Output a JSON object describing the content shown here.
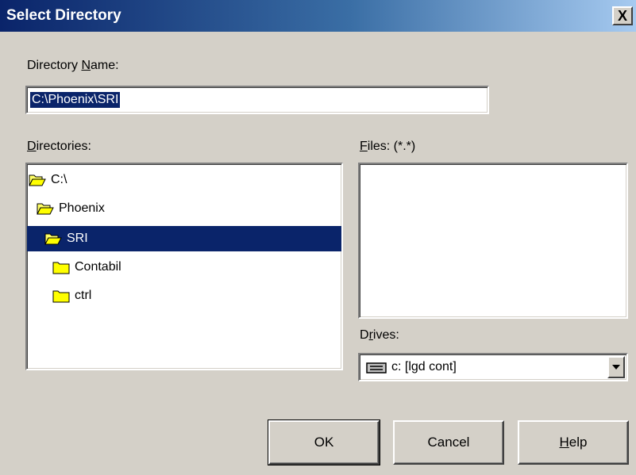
{
  "window": {
    "title": "Select Directory",
    "close_label": "X"
  },
  "directory_name": {
    "label_prefix": "Directory ",
    "label_accel": "N",
    "label_suffix": "ame:",
    "value": "C:\\Phoenix\\SRI"
  },
  "directories": {
    "label_accel": "D",
    "label_suffix": "irectories:",
    "items": [
      {
        "label": "C:\\",
        "type": "open-folder",
        "selected": false
      },
      {
        "label": "Phoenix",
        "type": "open-folder",
        "selected": false
      },
      {
        "label": "SRI",
        "type": "open-folder",
        "selected": true
      },
      {
        "label": "Contabil",
        "type": "closed-folder",
        "selected": false
      },
      {
        "label": "ctrl",
        "type": "closed-folder",
        "selected": false
      }
    ]
  },
  "files": {
    "label_accel": "F",
    "label_suffix": "iles: (*.*)",
    "items": []
  },
  "drives": {
    "label_prefix": "D",
    "label_accel": "r",
    "label_suffix": "ives:",
    "selected": "c: [lgd cont]",
    "icon": "drive-icon"
  },
  "buttons": {
    "ok": "OK",
    "cancel": "Cancel",
    "help_accel": "H",
    "help_suffix": "elp"
  },
  "colors": {
    "selection": "#0a246a",
    "dialog_bg": "#d4d0c8",
    "folder_fill": "#ffff00"
  }
}
